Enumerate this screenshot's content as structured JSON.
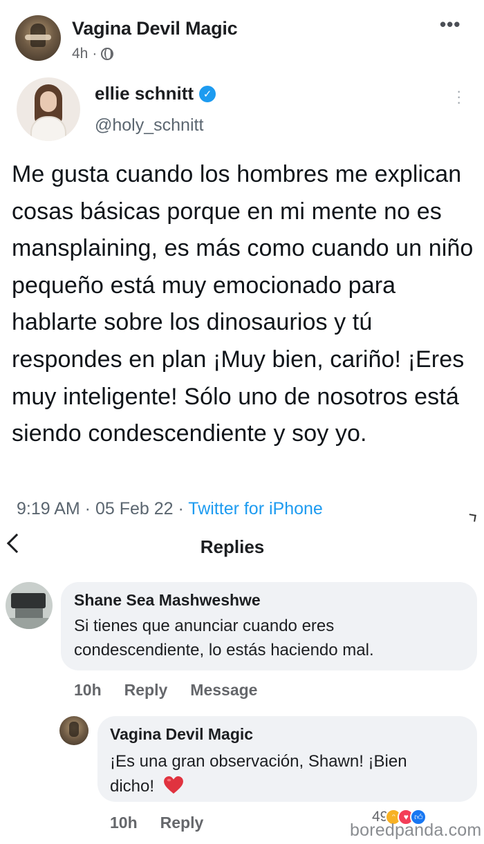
{
  "post": {
    "author": "Vagina Devil Magic",
    "time": "4h",
    "separator": "·",
    "menu_icon": "more-horizontal-icon",
    "privacy_icon": "globe-icon"
  },
  "tweet": {
    "name": "ellie schnitt",
    "handle": "@holy_schnitt",
    "verified_icon": "verified-badge-icon",
    "text": "Me gusta cuando los hombres me explican cosas básicas porque en mi mente no es mansplaining, es más como cuando un niño pequeño está muy emocionado para hablarte sobre los dinosaurios y tú respondes en plan ¡Muy bien, cariño! ¡Eres muy inteligente! Sólo uno de nosotros está siendo condescendiente y soy yo.",
    "timestamp": "9:19 AM · 05 Feb 22 · ",
    "source": "Twitter for iPhone",
    "accent_color": "#1d9bf0"
  },
  "replies": {
    "title": "Replies",
    "back_icon": "chevron-left-icon"
  },
  "comments": [
    {
      "author": "Shane Sea Mashweshwe",
      "text": "Si tienes que anunciar cuando eres condescendiente, lo estás haciendo mal.",
      "time": "10h",
      "reply_label": "Reply",
      "message_label": "Message"
    },
    {
      "author": "Vagina Devil Magic",
      "text": "¡Es una gran observación, Shawn! ¡Bien dicho!",
      "time": "10h",
      "reply_label": "Reply",
      "reaction_count": "49",
      "reactions": [
        "haha-icon",
        "love-icon",
        "like-icon"
      ]
    }
  ],
  "watermark": "boredpanda.com"
}
